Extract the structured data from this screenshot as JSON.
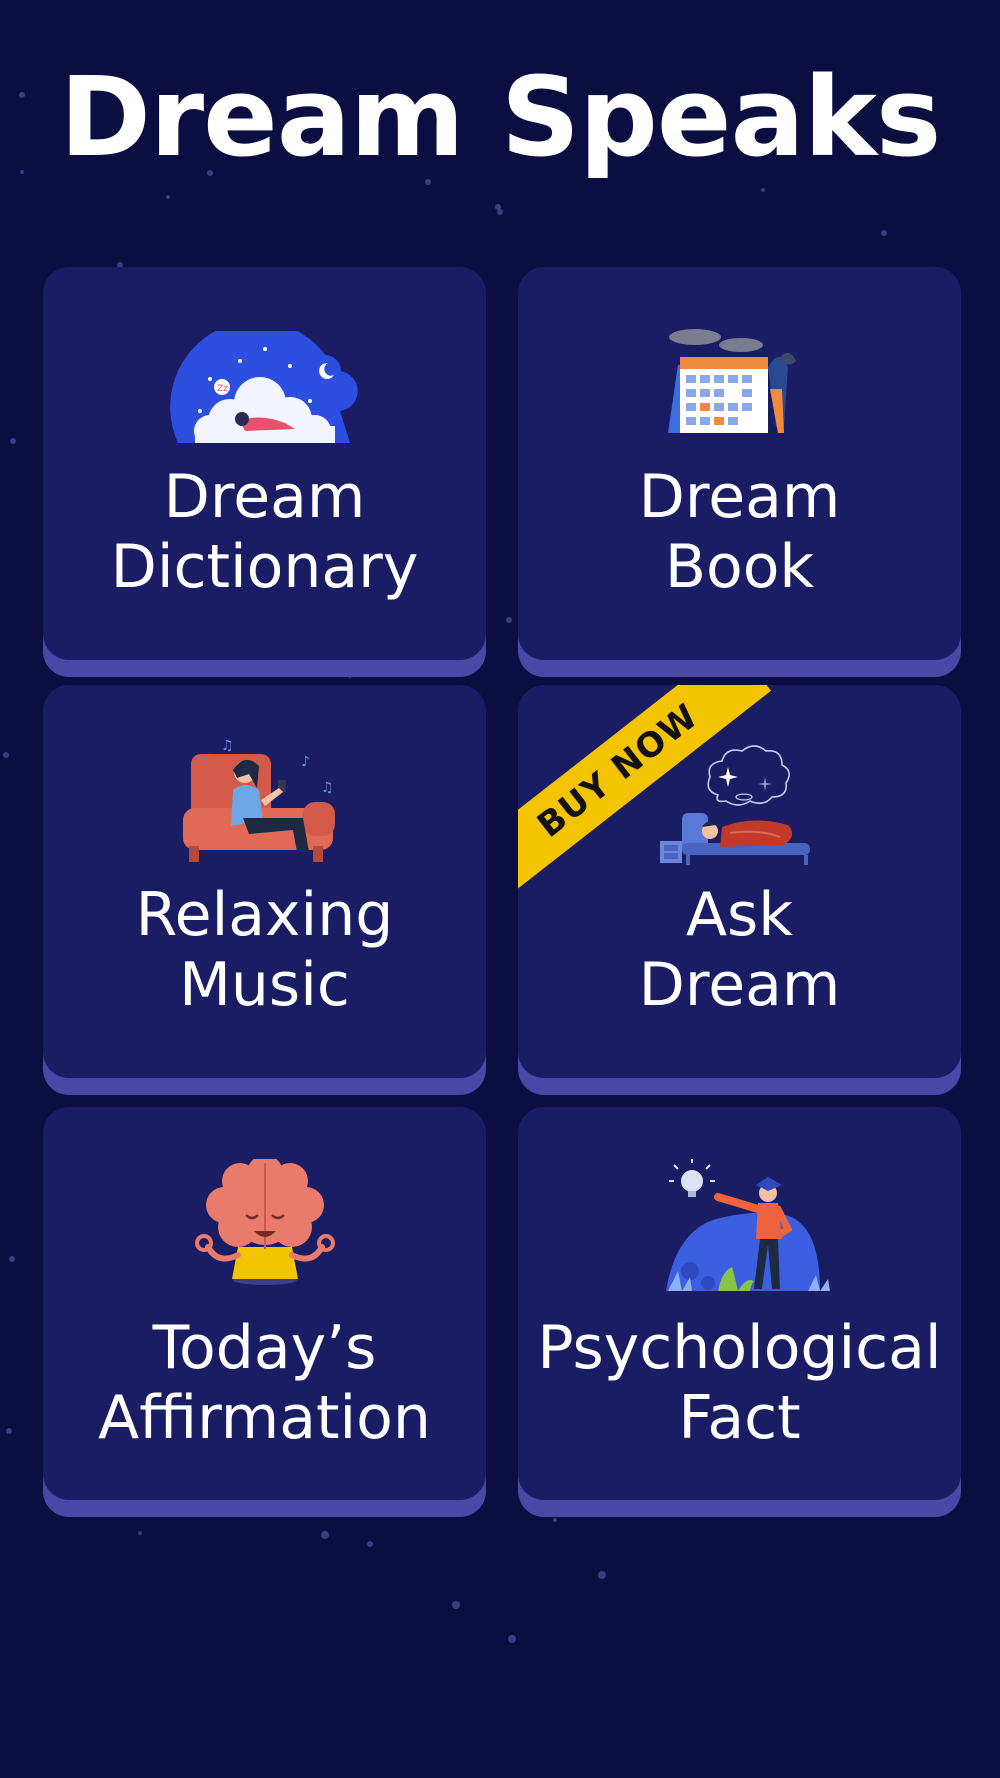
{
  "app": {
    "title": "Dream Speaks"
  },
  "cards": [
    {
      "line1": "Dream",
      "line2": "Dictionary",
      "icon": "sleeping-on-cloud-icon"
    },
    {
      "line1": "Dream",
      "line2": "Book",
      "icon": "calendar-icon"
    },
    {
      "line1": "Relaxing",
      "line2": "Music",
      "icon": "music-armchair-icon"
    },
    {
      "line1": "Ask",
      "line2": "Dream",
      "icon": "dreaming-bed-icon",
      "badge": "BUY NOW"
    },
    {
      "line1": "Today’s",
      "line2": "Affirmation",
      "icon": "meditating-brain-icon"
    },
    {
      "line1": "Psychological",
      "line2": "Fact",
      "icon": "idea-person-icon"
    }
  ],
  "colors": {
    "background": "#0c0e42",
    "card": "#1a1c64",
    "card_edge": "#4a47a6",
    "badge": "#f5c400"
  }
}
